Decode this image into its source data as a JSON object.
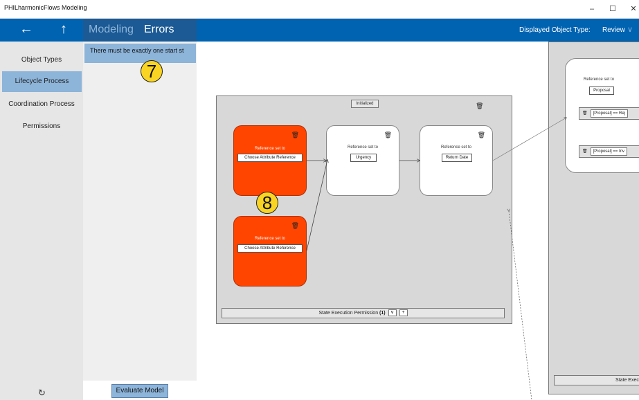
{
  "window": {
    "title": "PHILharmonicFlows Modeling",
    "minimize_glyph": "–",
    "maximize_glyph": "☐",
    "close_glyph": "✕"
  },
  "appbar": {
    "back_glyph": "←",
    "up_glyph": "↑",
    "tabs": [
      {
        "label": "Modeling"
      },
      {
        "label": "Errors"
      }
    ],
    "displayed_object_type_label": "Displayed Object Type:",
    "displayed_object_type_value": "Review",
    "chevron_glyph": "∨",
    "accent_color": "#0063b1"
  },
  "sidebar": {
    "items": [
      {
        "label": "Object Types"
      },
      {
        "label": "Lifecycle Process"
      },
      {
        "label": "Coordination Process"
      },
      {
        "label": "Permissions"
      }
    ],
    "sync_glyph": "↻"
  },
  "errors": {
    "items": [
      {
        "text": "There must be exactly one start st"
      }
    ],
    "evaluate_label": "Evaluate Model"
  },
  "markers": [
    {
      "number": "7"
    },
    {
      "number": "8"
    }
  ],
  "lifecycle": {
    "state_name": "Initialized",
    "trash_glyph": "🗑",
    "steps": [
      {
        "label": "Reference set to",
        "value": "Choose Attribute Reference",
        "status": "error"
      },
      {
        "label": "Reference set to",
        "value": "Urgency",
        "status": "ok"
      },
      {
        "label": "Reference set to",
        "value": "Return Date",
        "status": "ok"
      },
      {
        "label": "Reference set to",
        "value": "Choose Attribute Reference",
        "status": "error"
      }
    ],
    "permission_label": "State Execution Permission",
    "permission_count": "(1)",
    "expand_glyph": "∨",
    "add_glyph": "+",
    "error_color": "#ff4500"
  },
  "right_state": {
    "label": "Reference set to",
    "value": "Proposal",
    "conditions": [
      {
        "text": "[Proposal] == Rej"
      },
      {
        "text": "[Proposal] == Inv"
      }
    ],
    "permission_label": "State Exec"
  }
}
